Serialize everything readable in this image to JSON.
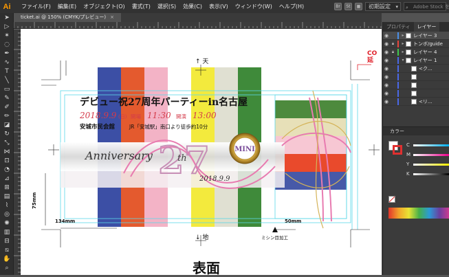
{
  "app": {
    "logo": "Ai"
  },
  "menu": [
    "ファイル(F)",
    "編集(E)",
    "オブジェクト(O)",
    "書式(T)",
    "選択(S)",
    "効果(C)",
    "表示(V)",
    "ウィンドウ(W)",
    "ヘルプ(H)"
  ],
  "menubar_right": {
    "workspace": "初期設定",
    "search_placeholder": "Adobe Stock を検索"
  },
  "document_tab": {
    "label": "ticket.ai @ 150% (CMYK/プレビュー)",
    "close": "×"
  },
  "tools": [
    "selection-tool-icon",
    "direct-selection-icon",
    "magic-wand-icon",
    "lasso-icon",
    "pen-icon",
    "curvature-icon",
    "type-icon",
    "line-icon",
    "rectangle-icon",
    "paintbrush-icon",
    "shaper-icon",
    "pencil-icon",
    "eraser-icon",
    "rotate-icon",
    "scale-icon",
    "width-icon",
    "free-transform-icon",
    "shape-builder-icon",
    "perspective-icon",
    "mesh-icon",
    "gradient-icon",
    "eyedropper-icon",
    "blend-icon",
    "symbol-sprayer-icon",
    "graph-icon",
    "artboard-icon",
    "slice-icon",
    "hand-icon",
    "zoom-icon"
  ],
  "panel": {
    "tabs": [
      "プロパティ",
      "レイヤー"
    ],
    "layers": [
      {
        "name": "レイヤー 3",
        "color": "#4a8fe8",
        "locked": false,
        "visible": true,
        "selected": true
      },
      {
        "name": "トンボ/guide",
        "color": "#e8453c",
        "locked": true,
        "visible": true,
        "selected": false
      },
      {
        "name": "レイヤー 4",
        "color": "#3ec94d",
        "locked": true,
        "visible": true,
        "selected": false
      },
      {
        "name": "レイヤー 1",
        "color": "#4a68e8",
        "locked": false,
        "visible": true,
        "selected": false
      },
      {
        "name": "<ク...",
        "color": "#4a68e8",
        "locked": false,
        "visible": true,
        "selected": false
      },
      {
        "name": "",
        "color": "#4a68e8",
        "locked": false,
        "visible": true,
        "selected": false
      },
      {
        "name": "",
        "color": "#4a68e8",
        "locked": false,
        "visible": true,
        "selected": false
      },
      {
        "name": "",
        "color": "#4a68e8",
        "locked": false,
        "visible": true,
        "selected": false
      },
      {
        "name": "<リ...",
        "color": "#4a68e8",
        "locked": false,
        "visible": true,
        "selected": false
      }
    ],
    "color_panel": {
      "title": "カラー",
      "channels": [
        "C",
        "M",
        "Y",
        "K"
      ]
    }
  },
  "ticket": {
    "annotation_red": "CO\n延",
    "top_label": "↑ 天",
    "bottom_label": "↓ 地",
    "title": "デビュー祝27周年パーティーin名古屋",
    "date": "2018.9.9",
    "day": "(日)",
    "open_label": "開場",
    "open_time": "11:30",
    "start_label": "開演",
    "start_time": "13:00",
    "venue": "安城市民会館",
    "access": "JR「安城駅」南口より徒歩約10分",
    "anniversary": "Anniversary",
    "big_number": "27",
    "superscript": "th",
    "badge": "MINI",
    "bottom_date": "2018.9.9",
    "dim_left": "134mm",
    "dim_height": "75mm",
    "dim_right": "50mm",
    "perforation": "ミシン目加工",
    "front_label": "表面"
  },
  "stripes_left": [
    "#3c4fa5",
    "#e45a2e",
    "#f3b3c6",
    "#ffffff",
    "#f3ea3d",
    "#e0e0d2",
    "#3f8a3a"
  ],
  "stripes_right": [
    "#4d8a3d",
    "#e7e0b8",
    "#f7c7d3",
    "#e94a2c",
    "#4759a8"
  ]
}
